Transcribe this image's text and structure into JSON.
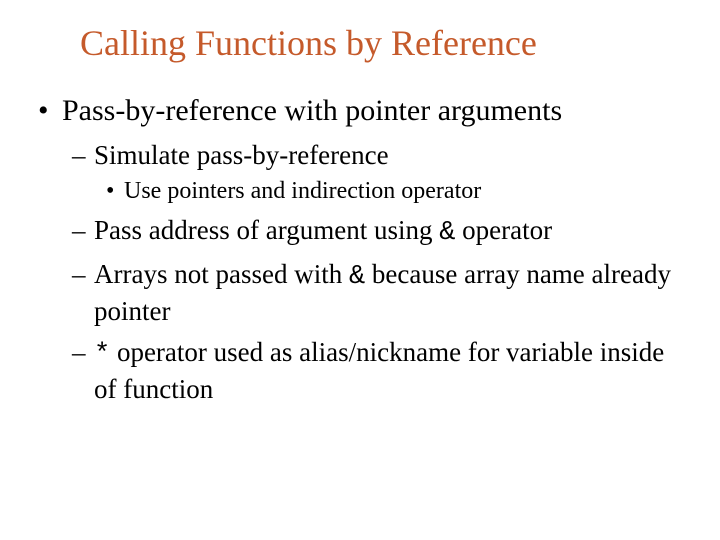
{
  "title": "Calling Functions by Reference",
  "bullets": {
    "l1_1": "Pass-by-reference with pointer arguments",
    "l2_1": "Simulate pass-by-reference",
    "l3_1": "Use pointers and indirection operator",
    "l2_2_pre": "Pass address of argument using ",
    "l2_2_code": "&",
    "l2_2_post": " operator",
    "l2_3_pre": "Arrays not passed with ",
    "l2_3_code": "&",
    "l2_3_post": " because array name already pointer",
    "l2_4_code": "*",
    "l2_4_post": " operator used as alias/nickname for variable inside of function"
  }
}
